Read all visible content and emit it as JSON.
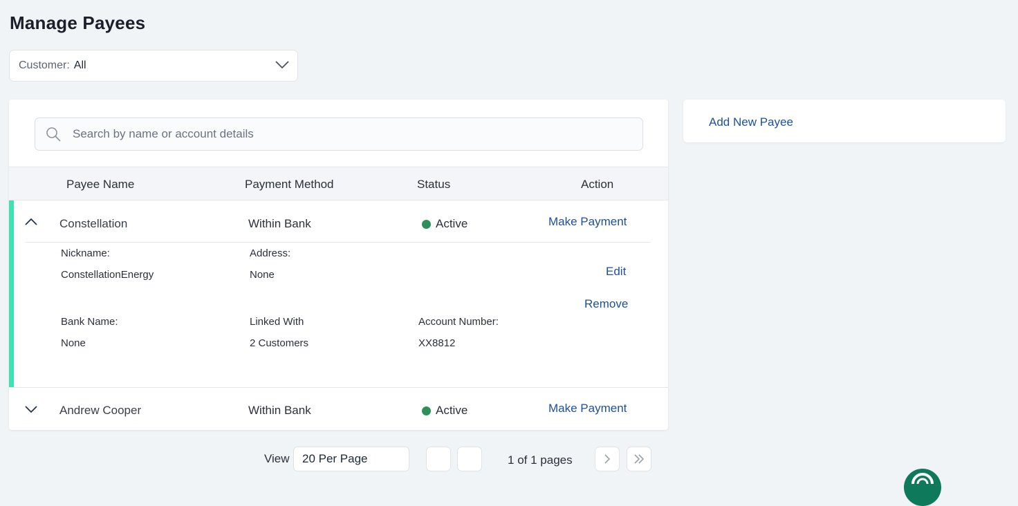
{
  "page": {
    "title": "Manage Payees"
  },
  "filter": {
    "label": "Customer:",
    "value": "All"
  },
  "search": {
    "placeholder": "Search by name or account details"
  },
  "table": {
    "headers": {
      "name": "Payee Name",
      "method": "Payment Method",
      "status": "Status",
      "action": "Action"
    },
    "rows": [
      {
        "name": "Constellation",
        "method": "Within Bank",
        "status": "Active",
        "action": "Make Payment",
        "expanded": true,
        "details": {
          "nickname_label": "Nickname:",
          "nickname": "ConstellationEnergy",
          "address_label": "Address:",
          "address": "None",
          "bank_label": "Bank Name:",
          "bank": "None",
          "linked_label": "Linked With",
          "linked": "2 Customers",
          "account_label": "Account Number:",
          "account": "XX8812",
          "edit": "Edit",
          "remove": "Remove"
        }
      },
      {
        "name": "Andrew Cooper",
        "method": "Within Bank",
        "status": "Active",
        "action": "Make Payment",
        "expanded": false
      }
    ]
  },
  "pagination": {
    "view_label": "View",
    "per_page": "20 Per Page",
    "current": "1",
    "of_text": "of 1 pages"
  },
  "side": {
    "add_payee": "Add New Payee"
  },
  "colors": {
    "accent": "#3ee3b2",
    "link": "#1d4f9c",
    "active": "#2f8f5a",
    "fab": "#0f7a5b"
  }
}
